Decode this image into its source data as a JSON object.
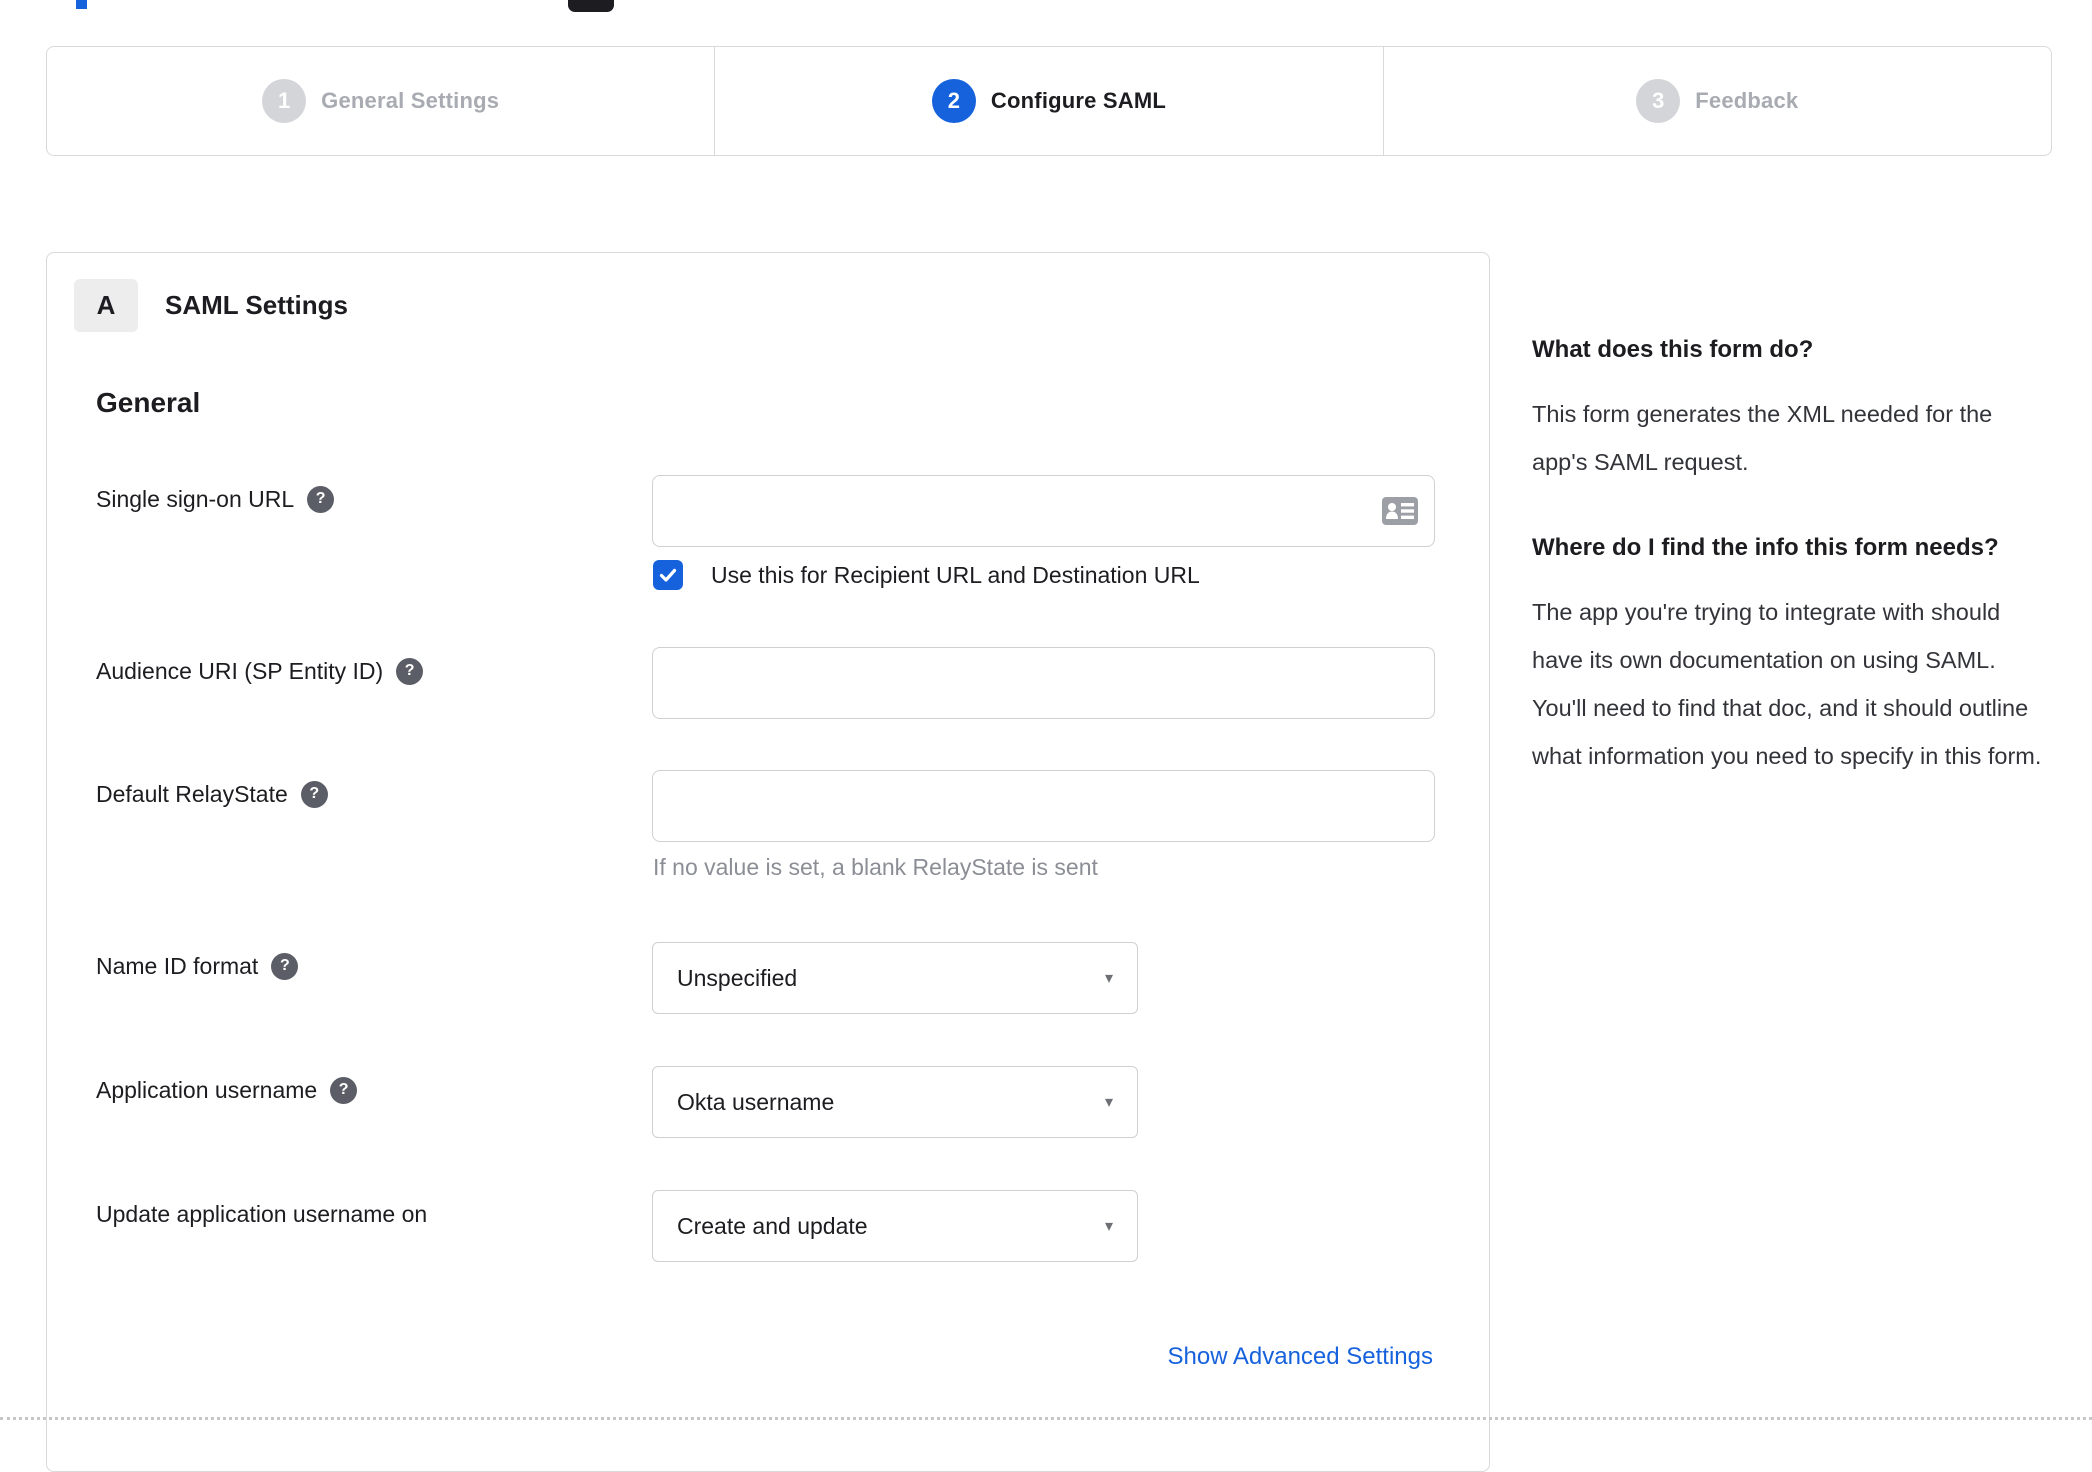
{
  "stepper": {
    "steps": [
      {
        "number": "1",
        "label": "General Settings",
        "state": "inactive"
      },
      {
        "number": "2",
        "label": "Configure SAML",
        "state": "active"
      },
      {
        "number": "3",
        "label": "Feedback",
        "state": "inactive"
      }
    ]
  },
  "panel": {
    "badge": "A",
    "title": "SAML Settings",
    "section_title": "General"
  },
  "form": {
    "sso": {
      "label": "Single sign-on URL",
      "value": "",
      "checkbox_checked": true,
      "checkbox_label": "Use this for Recipient URL and Destination URL"
    },
    "audience": {
      "label": "Audience URI (SP Entity ID)",
      "value": ""
    },
    "relay": {
      "label": "Default RelayState",
      "value": "",
      "hint": "If no value is set, a blank RelayState is sent"
    },
    "name_id": {
      "label": "Name ID format",
      "value": "Unspecified"
    },
    "app_username": {
      "label": "Application username",
      "value": "Okta username"
    },
    "update_username": {
      "label": "Update application username on",
      "value": "Create and update"
    },
    "advanced_link": "Show Advanced Settings"
  },
  "help_text": {
    "question_mark": "?"
  },
  "icons": {
    "help": "question-mark-circle-icon",
    "sso_input": "contact-card-icon",
    "checkbox": "checkmark-icon",
    "select": "caret-down-icon"
  },
  "sidebar": {
    "q1": "What does this form do?",
    "a1": "This form generates the XML needed for the app's SAML request.",
    "q2": "Where do I find the info this form needs?",
    "a2": "The app you're trying to integrate with should have its own documentation on using SAML. You'll need to find that doc, and it should outline what information you need to specify in this form."
  },
  "colors": {
    "accent_blue": "#1662dd",
    "link_blue": "#1662dd",
    "inactive_gray": "#d3d5d9",
    "border_gray": "#d8d9dd",
    "hint_gray": "#8c8e96"
  }
}
